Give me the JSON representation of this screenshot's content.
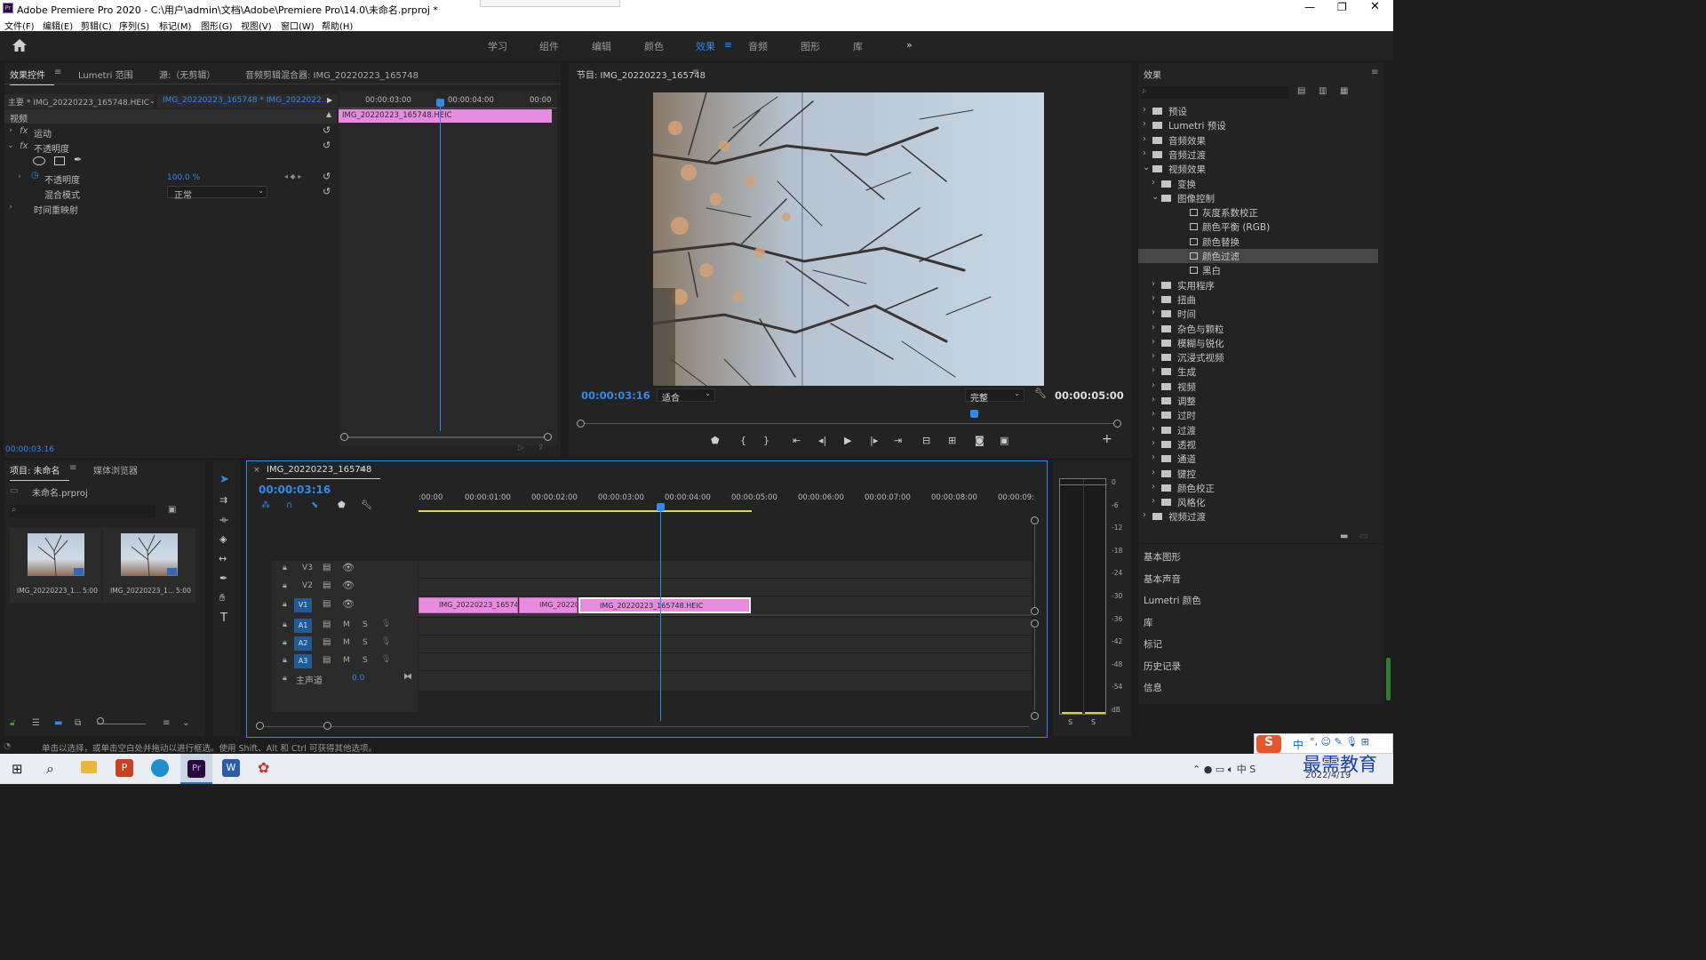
{
  "window": {
    "title": "Adobe Premiere Pro 2020 - C:\\用户\\admin\\文档\\Adobe\\Premiere Pro\\14.0\\未命名.prproj *"
  },
  "menu": [
    "文件(F)",
    "编辑(E)",
    "剪辑(C)",
    "序列(S)",
    "标记(M)",
    "图形(G)",
    "视图(V)",
    "窗口(W)",
    "帮助(H)"
  ],
  "workspaces": [
    "学习",
    "组件",
    "编辑",
    "颜色",
    "效果",
    "音频",
    "图形",
    "库"
  ],
  "active_workspace": "效果",
  "effect_controls": {
    "tabs": [
      "效果控件",
      "Lumetri 范围",
      "源:（无剪辑）",
      "音频剪辑混合器: IMG_20220223_165748"
    ],
    "master": "主要 * IMG_20220223_165748.HEIC",
    "seq": "IMG_20220223_165748 * IMG_2022022...",
    "video_label": "视频",
    "motion": "运动",
    "opacity": "不透明度",
    "opacity_param": "不透明度",
    "opacity_value": "100.0 %",
    "blend_mode_label": "混合模式",
    "blend_mode_value": "正常",
    "time_remap": "时间重映射",
    "timecode": "00:00:03:16",
    "ruler": [
      "00:00:03:00",
      "00:00:04:00",
      "00:00"
    ],
    "clip": "IMG_20220223_165748.HEIC"
  },
  "program": {
    "title": "节目: IMG_20220223_165748",
    "timecode": "00:00:03:16",
    "fit": "适合",
    "quality": "完整",
    "duration": "00:00:05:00"
  },
  "effects": {
    "title": "效果",
    "tree": [
      {
        "label": "预设",
        "level": 0,
        "folder": true
      },
      {
        "label": "Lumetri 预设",
        "level": 0,
        "folder": true
      },
      {
        "label": "音频效果",
        "level": 0,
        "folder": true
      },
      {
        "label": "音频过渡",
        "level": 0,
        "folder": true
      },
      {
        "label": "视频效果",
        "level": 0,
        "folder": true,
        "open": true
      },
      {
        "label": "变换",
        "level": 1,
        "folder": true
      },
      {
        "label": "图像控制",
        "level": 1,
        "folder": true,
        "open": true
      },
      {
        "label": "灰度系数校正",
        "level": 2
      },
      {
        "label": "颜色平衡 (RGB)",
        "level": 2
      },
      {
        "label": "颜色替换",
        "level": 2
      },
      {
        "label": "颜色过滤",
        "level": 2,
        "selected": true
      },
      {
        "label": "黑白",
        "level": 2
      },
      {
        "label": "实用程序",
        "level": 1,
        "folder": true
      },
      {
        "label": "扭曲",
        "level": 1,
        "folder": true
      },
      {
        "label": "时间",
        "level": 1,
        "folder": true
      },
      {
        "label": "杂色与颗粒",
        "level": 1,
        "folder": true
      },
      {
        "label": "模糊与锐化",
        "level": 1,
        "folder": true
      },
      {
        "label": "沉浸式视频",
        "level": 1,
        "folder": true
      },
      {
        "label": "生成",
        "level": 1,
        "folder": true
      },
      {
        "label": "视频",
        "level": 1,
        "folder": true
      },
      {
        "label": "调整",
        "level": 1,
        "folder": true
      },
      {
        "label": "过时",
        "level": 1,
        "folder": true
      },
      {
        "label": "过渡",
        "level": 1,
        "folder": true
      },
      {
        "label": "透视",
        "level": 1,
        "folder": true
      },
      {
        "label": "通道",
        "level": 1,
        "folder": true
      },
      {
        "label": "键控",
        "level": 1,
        "folder": true
      },
      {
        "label": "颜色校正",
        "level": 1,
        "folder": true
      },
      {
        "label": "风格化",
        "level": 1,
        "folder": true
      },
      {
        "label": "视频过渡",
        "level": 0,
        "folder": true
      }
    ],
    "sections": [
      "基本图形",
      "基本声音",
      "Lumetri 颜色",
      "库",
      "标记",
      "历史记录",
      "信息"
    ]
  },
  "project": {
    "tabs": [
      "项目: 未命名",
      "媒体浏览器"
    ],
    "file": "未命名.prproj",
    "items": [
      {
        "name": "IMG_20220223_1...",
        "dur": "5:00"
      },
      {
        "name": "IMG_20220223_1...",
        "dur": "5:00"
      }
    ]
  },
  "timeline": {
    "tab": "IMG_20220223_165748",
    "timecode": "00:00:03:16",
    "ruler": [
      ":00:00",
      "00:00:01:00",
      "00:00:02:00",
      "00:00:03:00",
      "00:00:04:00",
      "00:00:05:00",
      "00:00:06:00",
      "00:00:07:00",
      "00:00:08:00",
      "00:00:09:"
    ],
    "video_tracks": [
      "V3",
      "V2",
      "V1"
    ],
    "audio_tracks": [
      "A1",
      "A2",
      "A3"
    ],
    "master": "主声道",
    "master_val": "0.0",
    "clips": [
      "IMG_20220223_165748.H",
      "IMG_20220",
      "IMG_20220223_165748.HEIC"
    ],
    "mute": "M",
    "solo": "S"
  },
  "meter": {
    "scale": [
      "0",
      "-6",
      "-12",
      "-18",
      "-24",
      "-30",
      "-36",
      "-42",
      "-48",
      "-54",
      "dB"
    ],
    "solo": [
      "S",
      "S"
    ]
  },
  "status": "单击以选择，或单击空白处并拖动以进行框选。使用 Shift、Alt 和 Ctrl 可获得其他选项。",
  "taskbar": {
    "date": "2022/4/19",
    "ime": "中",
    "watermark": "最需教育"
  }
}
